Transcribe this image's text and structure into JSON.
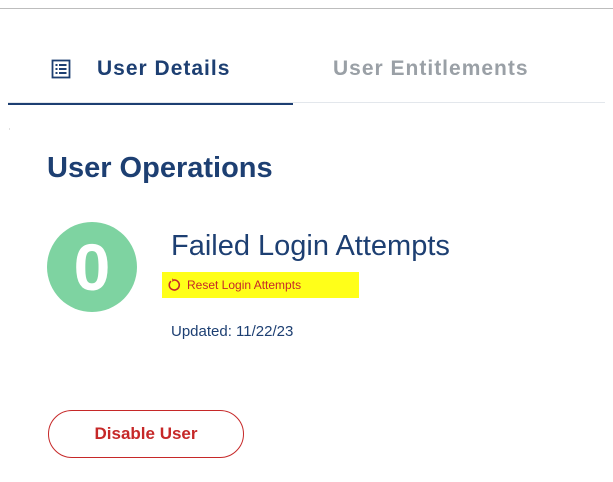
{
  "tabs": {
    "details_label": "User Details",
    "details_icon": "list-icon",
    "entitlements_label": "User Entitlements"
  },
  "section": {
    "title": "User Operations"
  },
  "login": {
    "failed_count": "0",
    "failed_title": "Failed Login Attempts",
    "reset_label": "Reset Login Attempts",
    "reset_icon": "reset-icon",
    "updated_text": "Updated: 11/22/23",
    "progress": 0
  },
  "actions": {
    "disable_label": "Disable User"
  },
  "colors": {
    "primary": "#1d3f72",
    "accent_green": "#7ed3a1",
    "danger": "#c62828",
    "highlight": "#ffff19",
    "muted": "#9aa0a6"
  }
}
